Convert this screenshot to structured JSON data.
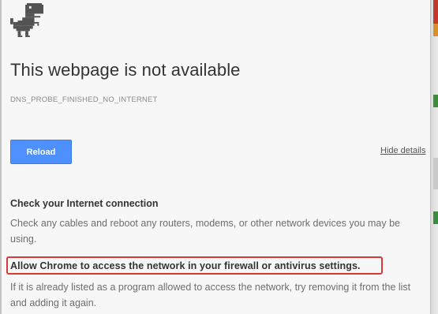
{
  "error_page": {
    "title": "This webpage is not available",
    "error_code": "DNS_PROBE_FINISHED_NO_INTERNET",
    "reload_label": "Reload",
    "hide_details_label": "Hide details",
    "suggestions": [
      {
        "heading": "Check your Internet connection",
        "body": "Check any cables and reboot any routers, modems, or other network devices you may be using."
      },
      {
        "heading": "Allow Chrome to access the network in your firewall or antivirus settings.",
        "body": "If it is already listed as a program allowed to access the network, try removing it from the list and adding it again."
      }
    ]
  },
  "icons": {
    "error_icon": "dinosaur-icon"
  },
  "colors": {
    "reload_button": "#4d90fe",
    "highlight_border": "#d8383a",
    "title_text": "#333333",
    "body_text": "#6e6e6e"
  }
}
